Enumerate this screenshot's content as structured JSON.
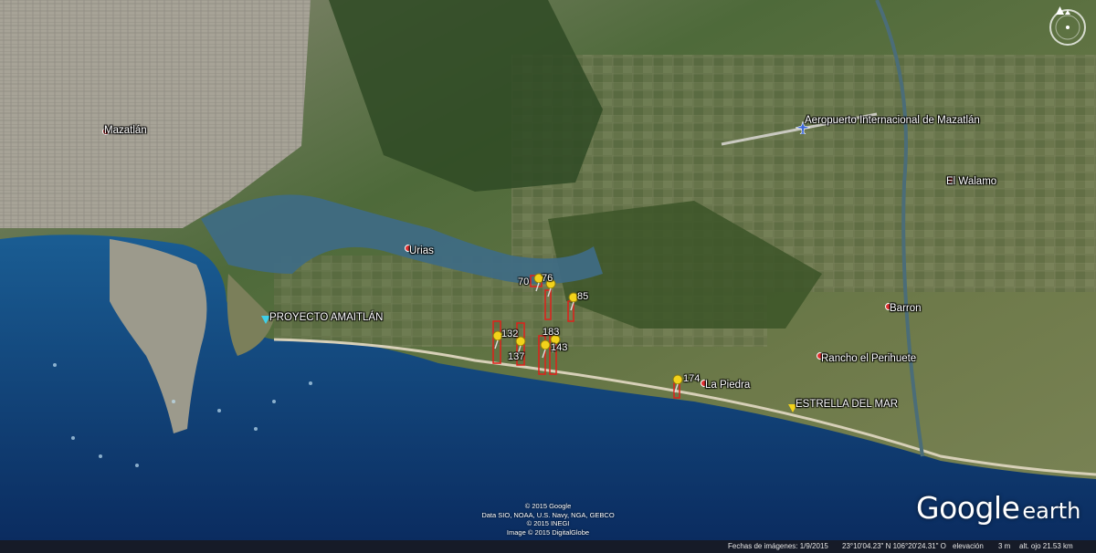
{
  "places": {
    "mazatlan": "Mazatlán",
    "urias": "Urias",
    "proyecto": "PROYECTO AMAITLÁN",
    "airport": "Aeropuerto Internacional de Mazatlán",
    "walamo": "El Walamo",
    "barron": "Barron",
    "perihuete": "Rancho el Perihuete",
    "lapiedra": "La Piedra",
    "estrella": "ESTRELLA DEL MAR"
  },
  "lots": {
    "l70": "70",
    "l76": "76",
    "l85": "85",
    "l132": "132",
    "l183": "183",
    "l137": "137",
    "l143": "143",
    "l174": "174"
  },
  "copyright": {
    "line1": "© 2015 Google",
    "line2": "Data SIO, NOAA, U.S. Navy, NGA, GEBCO",
    "line3": "© 2015 INEGI",
    "line4": "Image © 2015 DigitalGlobe"
  },
  "logo": {
    "google": "Google",
    "earth": "earth"
  },
  "status": {
    "imagery_date": "Fechas de imágenes: 1/9/2015",
    "coords": "23°10'04.23\" N  106°20'24.31\" O",
    "elevation_label": "elevación",
    "elevation": "3 m",
    "eye_alt": "alt. ojo  21.53 km"
  },
  "colors": {
    "sea": "#0c3a74",
    "land": "#6f7a4c",
    "pin": "#f2d21a",
    "lot": "#e0201a"
  }
}
